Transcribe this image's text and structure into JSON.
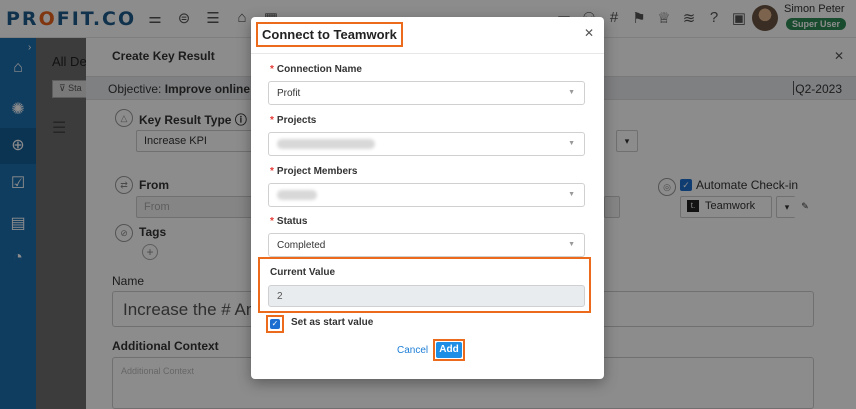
{
  "header": {
    "logo": "PROFIT.CO",
    "user_name": "Simon Peter",
    "user_role": "Super User"
  },
  "background": {
    "list_title": "All Dep",
    "filter_label": "Sta"
  },
  "panel": {
    "title": "Create Key Result",
    "objective_label": "Objective:",
    "objective_value": "Improve online help",
    "quarter": "Q2-2023",
    "kr_type_label": "Key Result Type",
    "kr_type_value": "Increase KPI",
    "from_label": "From",
    "from_placeholder": "From",
    "tags_label": "Tags",
    "automate_label": "Automate Check-in",
    "automate_tool": "Teamwork",
    "name_label": "Name",
    "name_value": "Increase the # Answ",
    "context_label": "Additional Context",
    "context_placeholder": "Additional Context"
  },
  "modal": {
    "title": "Connect to Teamwork",
    "connection_name_label": "Connection Name",
    "connection_name_value": "Profit",
    "projects_label": "Projects",
    "project_members_label": "Project Members",
    "status_label": "Status",
    "status_value": "Completed",
    "current_value_label": "Current Value",
    "current_value": "2",
    "set_start_label": "Set as start value",
    "cancel_label": "Cancel",
    "add_label": "Add"
  },
  "icons": [
    "grid-icon",
    "layers-icon",
    "list-icon",
    "building-icon",
    "calendar-icon",
    "folder-icon",
    "user-icon",
    "hashtag-icon",
    "flag-icon",
    "trophy-icon",
    "stack-icon",
    "help-icon",
    "chat-icon",
    "home-icon",
    "lightbulb-icon",
    "target-icon",
    "calendar-check-icon",
    "feedback-icon",
    "dashboard-icon"
  ],
  "colors": {
    "brand_blue": "#1c6fb0",
    "accent_orange": "#ec6a1c",
    "button_blue": "#1c8ee6"
  }
}
